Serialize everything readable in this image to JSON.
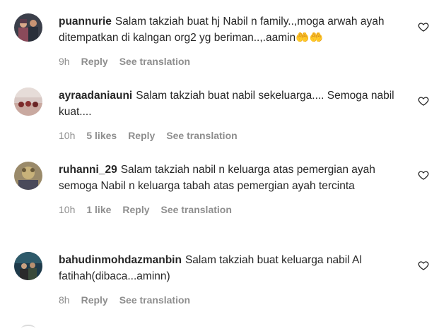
{
  "comments": [
    {
      "username": "puannurie",
      "text": "Salam takziah buat hj Nabil n family..,moga arwah ayah ditempatkan di kalngan org2 yg beriman..,.aamin🤲🤲",
      "time": "9h",
      "likes": "",
      "reply_label": "Reply",
      "translate_label": "See translation"
    },
    {
      "username": "ayraadaniauni",
      "text": "Salam takziah buat nabil sekeluarga.... Semoga nabil kuat....",
      "time": "10h",
      "likes": "5 likes",
      "reply_label": "Reply",
      "translate_label": "See translation"
    },
    {
      "username": "ruhanni_29",
      "text": "Salam takziah nabil n keluarga atas pemergian ayah semoga Nabil n keluarga tabah atas pemergian ayah tercinta",
      "time": "10h",
      "likes": "1 like",
      "reply_label": "Reply",
      "translate_label": "See translation"
    },
    {
      "username": "bahudinmohdazmanbin",
      "text": "Salam takziah buat keluarga nabil Al fatihah(dibaca...aminn)",
      "time": "8h",
      "likes": "",
      "reply_label": "Reply",
      "translate_label": "See translation"
    }
  ],
  "icons": {
    "like": "heart-outline-icon"
  },
  "colors": {
    "text": "#262626",
    "meta": "#8e8e8e"
  }
}
